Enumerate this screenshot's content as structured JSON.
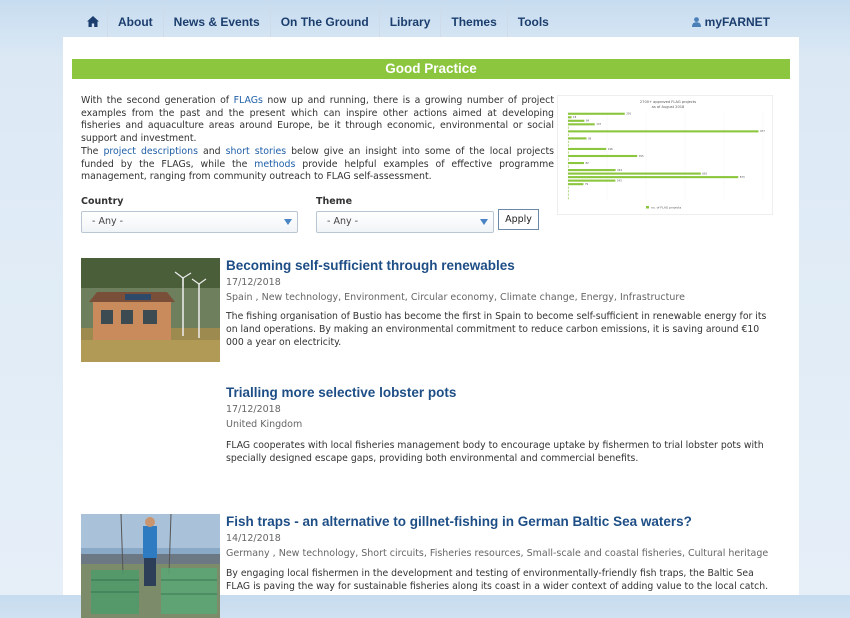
{
  "nav": {
    "items": [
      {
        "label": "About"
      },
      {
        "label": "News & Events"
      },
      {
        "label": "On The Ground"
      },
      {
        "label": "Library"
      },
      {
        "label": "Themes"
      },
      {
        "label": "Tools"
      }
    ],
    "account_label": "myFARNET"
  },
  "page": {
    "banner_title": "Good Practice"
  },
  "intro": {
    "p1_a": "With the second generation of ",
    "p1_link": "FLAGs",
    "p1_b": " now up and running, there is a growing number of project examples from the past and the present which can inspire other actions aimed at developing fisheries and aquaculture areas around Europe, be it through economic, environmental or social support and investment.",
    "p2_a": "The ",
    "p2_link1": "project descriptions",
    "p2_b": " and ",
    "p2_link2": "short stories",
    "p2_c": " below give an insight into some of the local projects funded by the FLAGs, while the ",
    "p2_link3": "methods",
    "p2_d": " provide helpful examples of effective programme management, ranging from community outreach to FLAG self-assessment."
  },
  "filters": {
    "country_label": "Country",
    "country_value": "- Any -",
    "theme_label": "Theme",
    "theme_value": "- Any -",
    "apply_label": "Apply"
  },
  "articles": [
    {
      "title": "Becoming self-sufficient through renewables",
      "date": "17/12/2018",
      "tags": "Spain , New technology, Environment, Circular economy, Climate change, Energy, Infrastructure",
      "summary": "The fishing organisation of Bustio has become the first in Spain to become self-sufficient in renewable energy for its on land operations. By making an environmental commitment to reduce carbon emissions, it is saving around €10 000 a year on electricity."
    },
    {
      "title": "Trialling more selective lobster pots",
      "date": "17/12/2018",
      "tags": "United Kingdom",
      "summary": "FLAG cooperates with local fisheries management body to encourage uptake by fishermen to trial lobster pots with specially designed escape gaps, providing both environmental and commercial benefits."
    },
    {
      "title": "Fish traps - an alternative to gillnet-fishing in German Baltic Sea waters?",
      "date": "14/12/2018",
      "tags": "Germany , New technology, Short circuits, Fisheries resources, Small-scale and coastal fisheries, Cultural heritage",
      "summary": "By engaging local fishermen in the development and testing of environmentally-friendly fish traps, the Baltic Sea FLAG is paving the way for sustainable fisheries along its coast in a wider context of adding value to the local catch."
    }
  ],
  "chart_data": {
    "type": "bar",
    "title": "2700+ approved FLAG projects as of August 2018",
    "legend": "no. of FLAG projects",
    "values": [
      291,
      18,
      84,
      137,
      0,
      977,
      0,
      95,
      0,
      0,
      196,
      0,
      355,
      0,
      82,
      0,
      244,
      681,
      873,
      243,
      79,
      0,
      0,
      0,
      0
    ],
    "xlim": [
      0,
      1000
    ],
    "color": "#8cc63e"
  },
  "colors": {
    "accent_green": "#8cc63e",
    "nav_text": "#1b3e6e",
    "title_blue": "#1e4e86",
    "link_blue": "#1f5fa8"
  }
}
